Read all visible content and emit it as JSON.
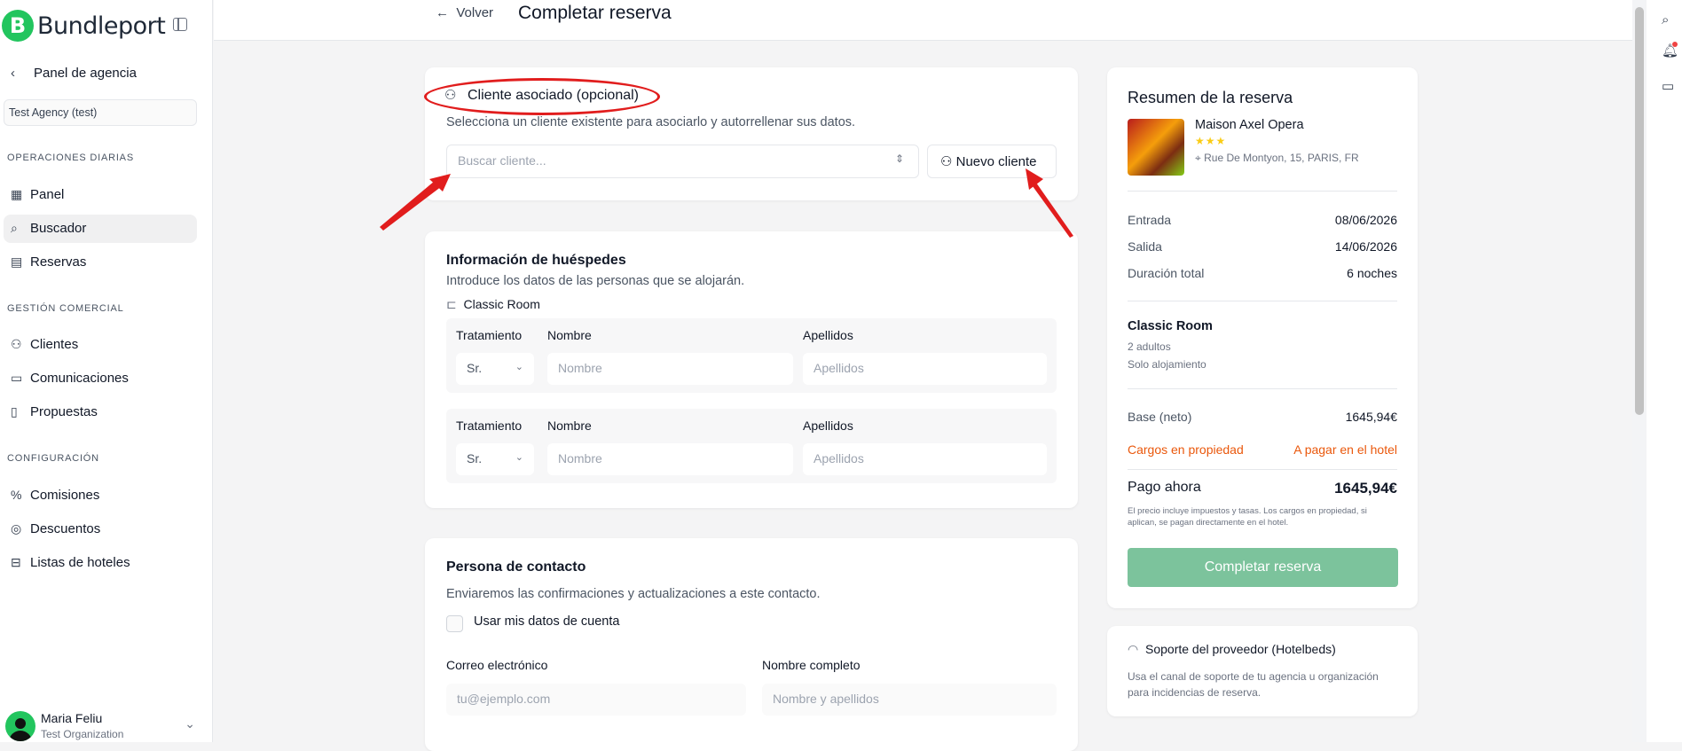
{
  "app": {
    "logo_text": "Bundleport",
    "logo_mark": "B"
  },
  "sidebar": {
    "back_label": "Panel de agencia",
    "agency": "Test Agency (test)",
    "sections": [
      {
        "title": "OPERACIONES DIARIAS",
        "items": [
          {
            "label": "Panel",
            "icon": "dashboard-icon"
          },
          {
            "label": "Buscador",
            "icon": "search-icon",
            "active": true
          },
          {
            "label": "Reservas",
            "icon": "calendar-icon"
          }
        ]
      },
      {
        "title": "GESTIÓN COMERCIAL",
        "items": [
          {
            "label": "Clientes",
            "icon": "users-icon"
          },
          {
            "label": "Comunicaciones",
            "icon": "message-icon"
          },
          {
            "label": "Propuestas",
            "icon": "document-icon"
          }
        ]
      },
      {
        "title": "CONFIGURACIÓN",
        "items": [
          {
            "label": "Comisiones",
            "icon": "commission-icon"
          },
          {
            "label": "Descuentos",
            "icon": "discount-icon"
          },
          {
            "label": "Listas de hoteles",
            "icon": "bookmark-icon"
          }
        ]
      }
    ],
    "user": {
      "name": "Maria Feliu",
      "org": "Test Organization"
    }
  },
  "header": {
    "back_label": "Volver",
    "title": "Completar reserva"
  },
  "client_card": {
    "title": "Cliente asociado (opcional)",
    "subtitle": "Selecciona un cliente existente para asociarlo y autorrellenar sus datos.",
    "search_placeholder": "Buscar cliente...",
    "new_client_label": "Nuevo cliente"
  },
  "guests_card": {
    "title": "Información de huéspedes",
    "subtitle": "Introduce los datos de las personas que se alojarán.",
    "room": "Classic Room",
    "label_treatment": "Tratamiento",
    "label_first": "Nombre",
    "label_last": "Apellidos",
    "guests": [
      {
        "treatment": "Sr.",
        "first_placeholder": "Nombre",
        "last_placeholder": "Apellidos"
      },
      {
        "treatment": "Sr.",
        "first_placeholder": "Nombre",
        "last_placeholder": "Apellidos"
      }
    ]
  },
  "contact_card": {
    "title": "Persona de contacto",
    "subtitle": "Enviaremos las confirmaciones y actualizaciones a este contacto.",
    "use_account_label": "Usar mis datos de cuenta",
    "use_account_checked": false,
    "email_label": "Correo electrónico",
    "email_placeholder": "tu@ejemplo.com",
    "fullname_label": "Nombre completo",
    "fullname_placeholder": "Nombre y apellidos"
  },
  "summary": {
    "title": "Resumen de la reserva",
    "hotel_name": "Maison Axel Opera",
    "stars": 3,
    "stars_text": "★★★",
    "address": "Rue De Montyon, 15, PARIS, FR",
    "checkin_label": "Entrada",
    "checkin": "08/06/2026",
    "checkout_label": "Salida",
    "checkout": "14/06/2026",
    "duration_label": "Duración total",
    "duration": "6 noches",
    "room_name": "Classic Room",
    "occupancy": "2 adultos",
    "board": "Solo alojamiento",
    "base_label": "Base (neto)",
    "base_value": "1645,94€",
    "charges_label": "Cargos en propiedad",
    "charges_value": "A pagar en el hotel",
    "pay_now_label": "Pago ahora",
    "pay_now_value": "1645,94€",
    "disclaimer": "El precio incluye impuestos y tasas. Los cargos en propiedad, si aplican, se pagan directamente en el hotel.",
    "complete_button": "Completar reserva",
    "accent_color": "#7cc39c",
    "warning_color": "#ea580c"
  },
  "support_card": {
    "title": "Soporte del proveedor (Hotelbeds)",
    "text": "Usa el canal de soporte de tu agencia u organización para incidencias de reserva."
  },
  "annotation_color": "#e11d1d"
}
